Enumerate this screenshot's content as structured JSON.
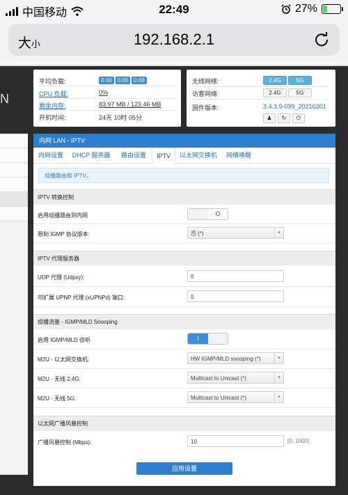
{
  "status_bar": {
    "carrier": "中国移动",
    "time": "22:49",
    "battery_percent": "27%",
    "battery_level": 0.27
  },
  "browser": {
    "text_size_main": "大",
    "text_size_small": "小",
    "url": "192.168.2.1"
  },
  "left_logo": "N",
  "system_info": {
    "load": {
      "label": "平均负载:",
      "values": [
        "0.00",
        "0.00",
        "0.00"
      ]
    },
    "cpu": {
      "label": "CPU 负载:",
      "value": "0%"
    },
    "memory": {
      "label": "剩余内存:",
      "value": "83.97 MB / 123.46 MB"
    },
    "uptime": {
      "label": "开机时间:",
      "value": "24天 10时 05分"
    }
  },
  "network_info": {
    "wireless": {
      "label": "无线网络:",
      "b24": "2.4G",
      "b5": "5G"
    },
    "guest": {
      "label": "访客网络:",
      "b24": "2.4G",
      "b5": "5G"
    },
    "firmware": {
      "label": "固件版本:",
      "value": "3.4.3.9-099_20210201"
    },
    "actions": [
      "person-icon",
      "refresh-icon",
      "power-icon"
    ]
  },
  "panel": {
    "title": "内网 LAN - IPTV",
    "tabs": [
      "内网设置",
      "DHCP 服务器",
      "路由设置",
      "IPTV",
      "以太网交换机",
      "网络唤醒"
    ],
    "active_tab": "IPTV",
    "notice": "组播路由和 IPTV。",
    "sections": {
      "iptv_transfer": {
        "title": "IPTV 转换控制",
        "enable_multicast_label": "启用组播路由到内网",
        "enable_multicast_state": "O",
        "igmp_version_label": "限制 IGMP 协议版本:",
        "igmp_version_value": "否 (*)"
      },
      "iptv_proxy": {
        "title": "IPTV 代理服务器",
        "udpxy_label": "UDP 代理 (Udpxy):",
        "udpxy_value": "0",
        "xupnpd_label": "可扩展 UPNP 代理 (xUPNPd) 端口:",
        "xupnpd_value": "0"
      },
      "igmp": {
        "title": "组播流量 - IGMP/MLD Snooping",
        "enable_snooping_label": "启用 IGMP/MLD 侦听",
        "enable_snooping_state": "I",
        "m2u_switch_label": "M2U - 以太网交换机:",
        "m2u_switch_value": "HW IGMP/MLD snooping (*)",
        "m2u_24_label": "M2U - 无线 2.4G:",
        "m2u_24_value": "Multicast to Unicast (*)",
        "m2u_5_label": "M2U - 无线 5G:",
        "m2u_5_value": "Multicast to Unicast (*)"
      },
      "storm": {
        "title": "以太网广播风暴控制",
        "rate_label": "广播风暴控制 (Mbps):",
        "rate_value": "10",
        "rate_hint": "[0..1000]"
      }
    },
    "apply_label": "应用设置"
  }
}
